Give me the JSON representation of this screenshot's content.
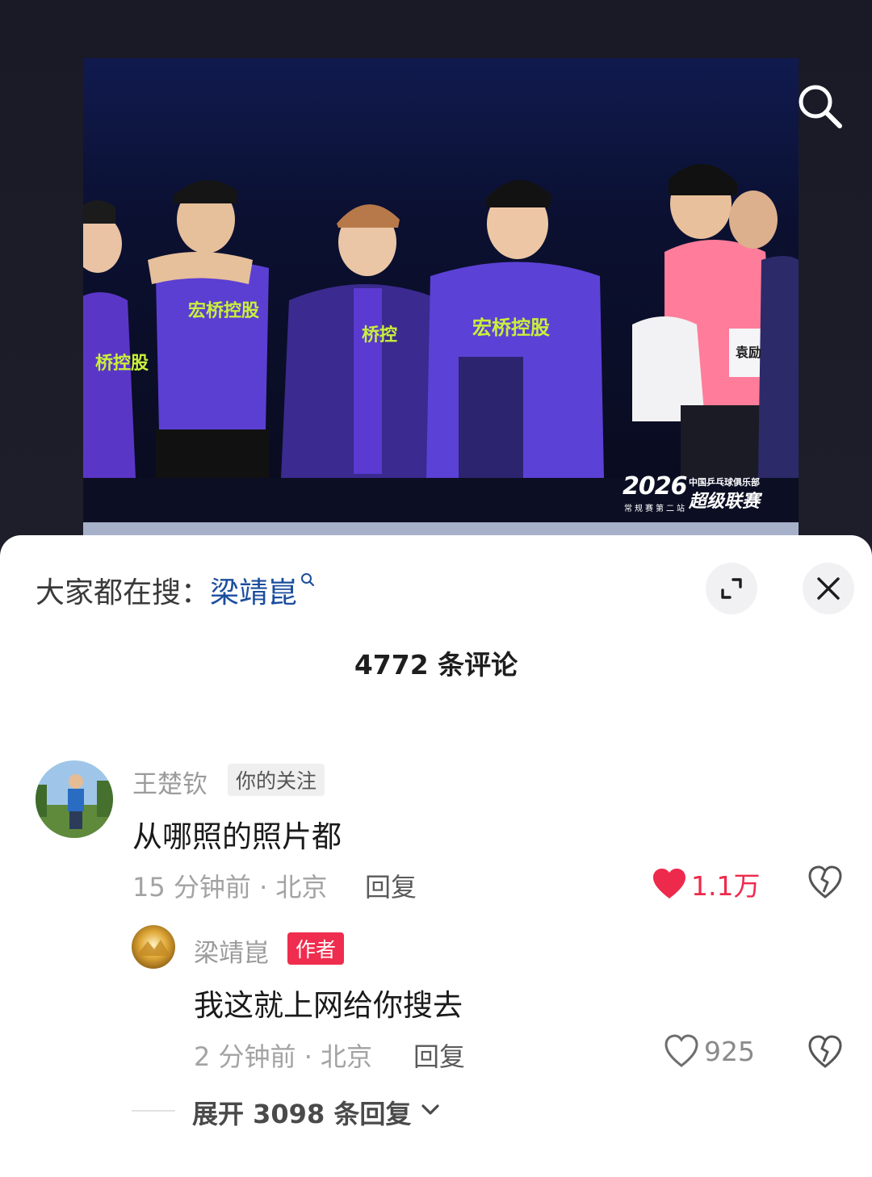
{
  "post": {
    "photo_watermark": {
      "year": "2026",
      "line_top": "中国乒乓球俱乐部",
      "line_main": "超级联赛",
      "line_sub": "常规赛第二站"
    }
  },
  "icons": {
    "search": "search-icon",
    "expand": "expand-icon",
    "close": "close-icon",
    "heart_filled": "heart-filled-icon",
    "heart_outline": "heart-outline-icon",
    "dislike": "broken-heart-icon",
    "chevron": "chevron-down-icon"
  },
  "hot_search": {
    "prefix": "大家都在搜：",
    "keyword": "梁靖崑"
  },
  "comments_header": {
    "count_label": "4772 条评论"
  },
  "comments": [
    {
      "username": "王楚钦",
      "tag": "你的关注",
      "text": "从哪照的照片都",
      "time_location": "15 分钟前 · 北京",
      "reply_label": "回复",
      "likes": "1.1万",
      "liked": true
    },
    {
      "username": "梁靖崑",
      "tag": "作者",
      "text": "我这就上网给你搜去",
      "time_location": "2 分钟前 · 北京",
      "reply_label": "回复",
      "likes": "925",
      "liked": false
    }
  ],
  "expand_replies": {
    "label": "展开 3098 条回复"
  },
  "colors": {
    "like_red": "#ee2a4c",
    "author_tag": "#ef2d4e",
    "keyword_blue": "#1a4d9c"
  }
}
